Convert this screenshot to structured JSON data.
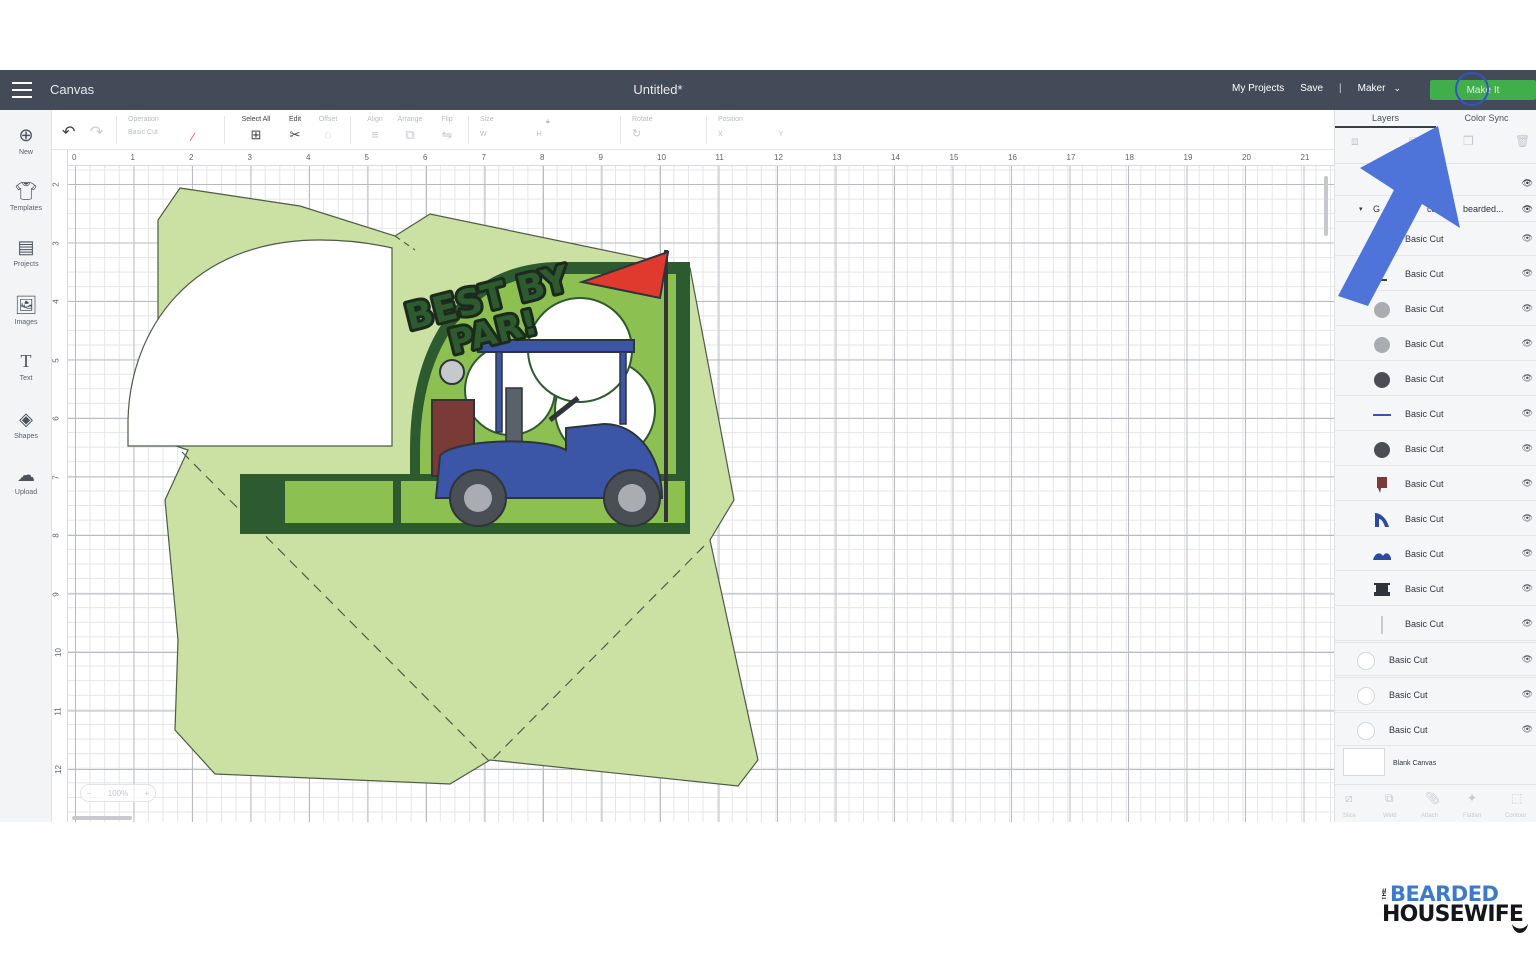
{
  "topbar": {
    "menu_icon": "hamburger-icon",
    "brand": "Canvas",
    "doc_title": "Untitled*",
    "my_projects": "My Projects",
    "save": "Save",
    "separator": "|",
    "machine": "Maker",
    "make_it": "Make It"
  },
  "toolbar": {
    "operation_label": "Operation",
    "operation_value": "Basic Cut",
    "select_all": "Select All",
    "edit": "Edit",
    "offset": "Offset",
    "align": "Align",
    "arrange": "Arrange",
    "flip": "Flip",
    "size": "Size",
    "rotate": "Rotate",
    "position": "Position",
    "size_w": "W",
    "size_h": "H",
    "pos_x": "X",
    "pos_y": "Y"
  },
  "sidebar": {
    "items": [
      {
        "label": "New",
        "icon": "plus-circle-icon"
      },
      {
        "label": "Templates",
        "icon": "tshirt-icon"
      },
      {
        "label": "Projects",
        "icon": "projects-icon"
      },
      {
        "label": "Images",
        "icon": "image-icon"
      },
      {
        "label": "Text",
        "icon": "text-icon"
      },
      {
        "label": "Shapes",
        "icon": "shapes-icon"
      },
      {
        "label": "Upload",
        "icon": "upload-icon"
      }
    ]
  },
  "ruler": {
    "top": [
      "0",
      "1",
      "2",
      "3",
      "4",
      "5",
      "6",
      "7",
      "8",
      "9",
      "10",
      "11",
      "12",
      "13",
      "14",
      "15",
      "16",
      "17",
      "18",
      "19",
      "20",
      "21"
    ],
    "left": [
      "2",
      "3",
      "4",
      "5",
      "6",
      "7",
      "8",
      "9",
      "10",
      "11",
      "12"
    ]
  },
  "canvas": {
    "art_text_1": "BEST BY",
    "art_text_2": "PAR!",
    "zoom_label": "100%",
    "colors": {
      "envelope_fill": "#cbe0a3",
      "dark_green": "#2d5a2e",
      "mid_green": "#8cc152",
      "flag_red": "#e03a2f",
      "cart_blue": "#3b56a6",
      "bag_brown": "#7a3b36"
    }
  },
  "panel": {
    "tab_layers": "Layers",
    "tab_color_sync": "Color Sync",
    "group_label": "G",
    "group_fragment": "ca",
    "group_name": "bearded...",
    "layers": [
      {
        "name": "Basic Cut",
        "color": "#2d5a2e",
        "shape": "leaf"
      },
      {
        "name": "Basic Cut",
        "color": "#3a3f46",
        "shape": "line-dark"
      },
      {
        "name": "Basic Cut",
        "color": "#a9acb0",
        "shape": "circle"
      },
      {
        "name": "Basic Cut",
        "color": "#a9acb0",
        "shape": "circle"
      },
      {
        "name": "Basic Cut",
        "color": "#4a4e55",
        "shape": "circle"
      },
      {
        "name": "Basic Cut",
        "color": "#3b56a6",
        "shape": "line"
      },
      {
        "name": "Basic Cut",
        "color": "#4a4e55",
        "shape": "circle"
      },
      {
        "name": "Basic Cut",
        "color": "#7a3b36",
        "shape": "bag"
      },
      {
        "name": "Basic Cut",
        "color": "#2c4aa0",
        "shape": "seat"
      },
      {
        "name": "Basic Cut",
        "color": "#2c4aa0",
        "shape": "fender"
      },
      {
        "name": "Basic Cut",
        "color": "#2f343a",
        "shape": "cart"
      },
      {
        "name": "Basic Cut",
        "color": "#c9cbce",
        "shape": "pole"
      },
      {
        "name": "Basic Cut",
        "color": "#ffffff",
        "shape": "circle-outline"
      },
      {
        "name": "Basic Cut",
        "color": "#ffffff",
        "shape": "circle-outline"
      },
      {
        "name": "Basic Cut",
        "color": "#ffffff",
        "shape": "circle-outline"
      }
    ],
    "blank_canvas": "Blank Canvas",
    "bottom_actions": [
      "Slice",
      "Weld",
      "Attach",
      "Flatten",
      "Contour"
    ],
    "top_actions": [
      "Group",
      "Ungroup",
      "Duplicate",
      "Delete"
    ]
  },
  "logo": {
    "the": "THE",
    "line1": "BEARDED",
    "line2": "HOUSEWIFE"
  },
  "accent": {
    "arrow": "#4f74d9",
    "ring": "#2f55c7",
    "make_green": "#3fae4b"
  }
}
